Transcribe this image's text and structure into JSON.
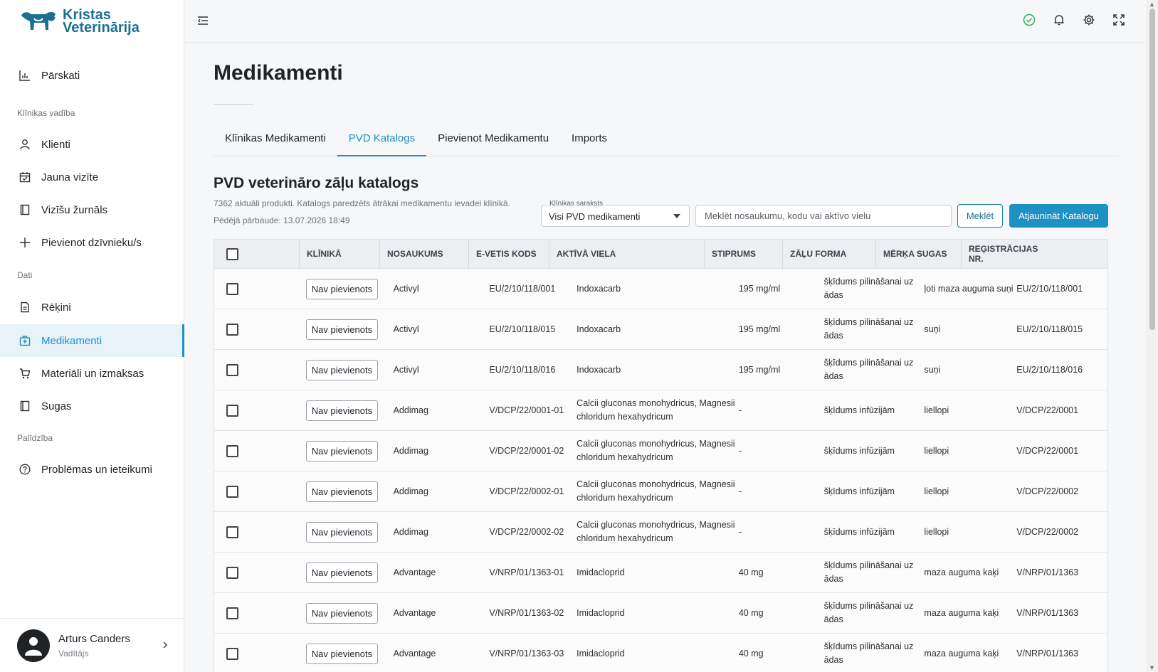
{
  "brand": {
    "line1": "Kristas",
    "line2": "Veterinārija"
  },
  "sidebar": {
    "overview": "Pārskati",
    "section_clinic": "Klīnikas vadība",
    "clients": "Klienti",
    "new_visit": "Jauna vizīte",
    "visit_log": "Vizīšu žurnāls",
    "add_animal": "Pievienot dzīvnieku/s",
    "section_data": "Dati",
    "invoices": "Rēķini",
    "medicines": "Medikamenti",
    "materials": "Materiāli un izmaksas",
    "species": "Sugas",
    "section_help": "Palīdzība",
    "feedback": "Problēmas un ieteikumi"
  },
  "user": {
    "name": "Arturs Canders",
    "role": "Vadītājs"
  },
  "page": {
    "title": "Medikamenti"
  },
  "tabs": [
    "Klīnikas Medikamenti",
    "PVD Katalogs",
    "Pievienot Medikamentu",
    "Imports"
  ],
  "catalog": {
    "title": "PVD veterināro zāļu katalogs",
    "subtitle": "7362 aktuāli produkti. Katalogs paredzēts ātrākai medikamentu ievadei klīnikā.",
    "last_check": "Pēdējā pārbaude: 13.07.2026 18:49",
    "filter_label": "Klīnikas saraksts",
    "filter_value": "Visi PVD medikamenti",
    "search_placeholder": "Meklēt nosaukumu, kodu vai aktīvo vielu",
    "search_button": "Meklēt",
    "update_button": "Atjaunināt Katalogu"
  },
  "table": {
    "headers": [
      "KLĪNIKĀ",
      "NOSAUKUMS",
      "E-VETIS KODS",
      "AKTĪVĀ VIELA",
      "STIPRUMS",
      "ZĀĻU FORMA",
      "MĒRĶA SUGAS",
      "REĢISTRĀCIJAS NR."
    ],
    "rows": [
      {
        "status": "Nav pievienots",
        "name": "Activyl",
        "code": "EU/2/10/118/001",
        "substance": "Indoxacarb",
        "strength": "195 mg/ml",
        "form": "šķīdums pilināšanai uz ādas",
        "species": "ļoti maza auguma suņi",
        "reg": "EU/2/10/118/001"
      },
      {
        "status": "Nav pievienots",
        "name": "Activyl",
        "code": "EU/2/10/118/015",
        "substance": "Indoxacarb",
        "strength": "195 mg/ml",
        "form": "šķīdums pilināšanai uz ādas",
        "species": "suņi",
        "reg": "EU/2/10/118/015"
      },
      {
        "status": "Nav pievienots",
        "name": "Activyl",
        "code": "EU/2/10/118/016",
        "substance": "Indoxacarb",
        "strength": "195 mg/ml",
        "form": "šķīdums pilināšanai uz ādas",
        "species": "suņi",
        "reg": "EU/2/10/118/016"
      },
      {
        "status": "Nav pievienots",
        "name": "Addimag",
        "code": "V/DCP/22/0001-01",
        "substance": "Calcii gluconas monohydricus, Magnesii chloridum hexahydricum",
        "strength": "-",
        "form": "šķīdums infūzijām",
        "species": "liellopi",
        "reg": "V/DCP/22/0001"
      },
      {
        "status": "Nav pievienots",
        "name": "Addimag",
        "code": "V/DCP/22/0001-02",
        "substance": "Calcii gluconas monohydricus, Magnesii chloridum hexahydricum",
        "strength": "-",
        "form": "šķīdums infūzijām",
        "species": "liellopi",
        "reg": "V/DCP/22/0001"
      },
      {
        "status": "Nav pievienots",
        "name": "Addimag",
        "code": "V/DCP/22/0002-01",
        "substance": "Calcii gluconas monohydricus, Magnesii chloridum hexahydricum",
        "strength": "-",
        "form": "šķīdums infūzijām",
        "species": "liellopi",
        "reg": "V/DCP/22/0002"
      },
      {
        "status": "Nav pievienots",
        "name": "Addimag",
        "code": "V/DCP/22/0002-02",
        "substance": "Calcii gluconas monohydricus, Magnesii chloridum hexahydricum",
        "strength": "-",
        "form": "šķīdums infūzijām",
        "species": "liellopi",
        "reg": "V/DCP/22/0002"
      },
      {
        "status": "Nav pievienots",
        "name": "Advantage",
        "code": "V/NRP/01/1363-01",
        "substance": "Imidacloprid",
        "strength": "40 mg",
        "form": "šķīdums pilināšanai uz ādas",
        "species": "maza auguma kaķi",
        "reg": "V/NRP/01/1363"
      },
      {
        "status": "Nav pievienots",
        "name": "Advantage",
        "code": "V/NRP/01/1363-02",
        "substance": "Imidacloprid",
        "strength": "40 mg",
        "form": "šķīdums pilināšanai uz ādas",
        "species": "maza auguma kaķi",
        "reg": "V/NRP/01/1363"
      },
      {
        "status": "Nav pievienots",
        "name": "Advantage",
        "code": "V/NRP/01/1363-03",
        "substance": "Imidacloprid",
        "strength": "40 mg",
        "form": "šķīdums pilināšanai uz ādas",
        "species": "maza auguma kaķi",
        "reg": "V/NRP/01/1363"
      }
    ]
  },
  "colors": {
    "accent": "#1e90c2",
    "brand": "#1d6f92",
    "status_ok": "#2fb25a"
  }
}
